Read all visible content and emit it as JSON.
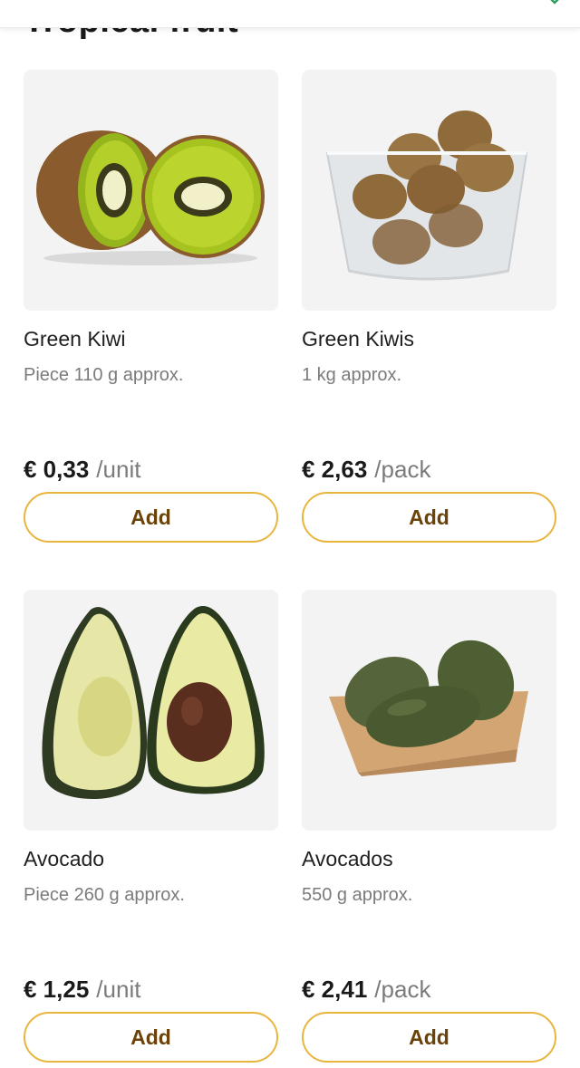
{
  "section": {
    "title": "Tropical fruit"
  },
  "products": [
    {
      "name": "Green Kiwi",
      "weight": "Piece 110 g approx.",
      "price": "€ 0,33",
      "unit": "/unit",
      "add_label": "Add",
      "image": "halved-kiwi"
    },
    {
      "name": "Green Kiwis",
      "weight": "1 kg approx.",
      "price": "€ 2,63",
      "unit": "/pack",
      "add_label": "Add",
      "image": "kiwis-in-plastic-tray"
    },
    {
      "name": "Avocado",
      "weight": "Piece 260 g approx.",
      "price": "€ 1,25",
      "unit": "/unit",
      "add_label": "Add",
      "image": "halved-avocado"
    },
    {
      "name": "Avocados",
      "weight": "550 g approx.",
      "price": "€ 2,41",
      "unit": "/pack",
      "add_label": "Add",
      "image": "avocados-in-cardboard-tray"
    }
  ],
  "colors": {
    "button_border": "#e8b53d",
    "button_text": "#6b4208",
    "card_background": "#f3f3f3",
    "secondary_text": "#7b7b7b",
    "corner_icon": "#2e9e5b"
  }
}
